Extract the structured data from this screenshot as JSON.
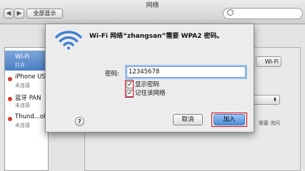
{
  "window": {
    "title": "网络",
    "show_all_label": "全部显示",
    "back_label": "◀",
    "forward_label": "▶"
  },
  "sidebar": {
    "items": [
      {
        "name": "Wi-Fi",
        "status": "打开",
        "selected": true
      },
      {
        "name": "iPhone USB",
        "status": "未连接"
      },
      {
        "name": "蓝牙 PAN",
        "status": "未连接"
      },
      {
        "name": "Thund...olt",
        "status": "未连接"
      }
    ]
  },
  "background": {
    "wifi_button_label": "Wi-Fi",
    "popup_value": "",
    "ask_hint": "需要 询问"
  },
  "dialog": {
    "title": "Wi-Fi 网络“zhangsan”需要 WPA2 密码。",
    "password_label": "密码:",
    "password_value": "12345678",
    "show_password_label": "显示密码",
    "show_password_checked": true,
    "remember_network_label": "记住该网络",
    "remember_network_checked": true,
    "help_label": "?",
    "cancel_label": "取消",
    "join_label": "加入"
  },
  "colors": {
    "highlight": "#d0021b",
    "accent": "#4d8fdd",
    "status_dot": "#d93a2b"
  }
}
